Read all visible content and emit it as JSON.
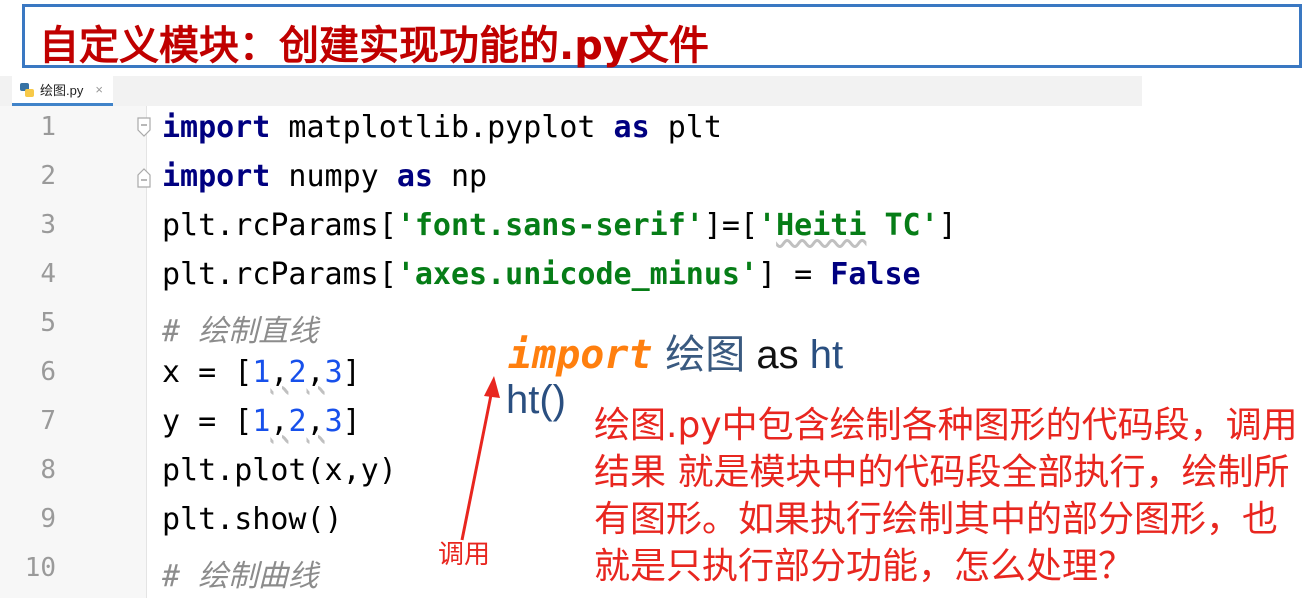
{
  "title": "自定义模块：创建实现功能的.py文件",
  "tab": {
    "filename": "绘图.py",
    "close": "×"
  },
  "editor": {
    "lines": [
      {
        "n": "1"
      },
      {
        "n": "2"
      },
      {
        "n": "3"
      },
      {
        "n": "4"
      },
      {
        "n": "5"
      },
      {
        "n": "6"
      },
      {
        "n": "7"
      },
      {
        "n": "8"
      },
      {
        "n": "9"
      },
      {
        "n": "10"
      }
    ],
    "code": {
      "l1": {
        "kw1": "import",
        "mod": " matplotlib.pyplot ",
        "kw2": "as",
        "alias": " plt"
      },
      "l2": {
        "kw1": "import",
        "mod": " numpy ",
        "kw2": "as",
        "alias": " np"
      },
      "l3": {
        "a": "plt.rcParams[",
        "s1": "'font.sans-serif'",
        "b": "]=[",
        "s2a": "'",
        "s2b": "Heiti",
        "s2c": " TC'",
        "c": "]"
      },
      "l4": {
        "a": "plt.rcParams[",
        "s1": "'axes.unicode_minus'",
        "b": "] = ",
        "kw": "False"
      },
      "l5": {
        "c": "# 绘制直线"
      },
      "l6": {
        "a": "x = [",
        "n1": "1",
        "c1": ",",
        "n2": "2",
        "c2": ",",
        "n3": "3",
        "b": "]"
      },
      "l7": {
        "a": "y = [",
        "n1": "1",
        "c1": ",",
        "n2": "2",
        "c2": ",",
        "n3": "3",
        "b": "]"
      },
      "l8": {
        "a": "plt.plot(x,y)"
      },
      "l9": {
        "a": "plt.show()"
      },
      "l10": {
        "c": "# 绘制曲线"
      }
    }
  },
  "annotation": {
    "import_kw": "import",
    "import_mod": " 绘图",
    "import_as": " as",
    "import_alias": " ht",
    "call": "ht()",
    "arrow_label": "调用",
    "note": "绘图.py中包含绘制各种图形的代码段，调用结果 就是模块中的代码段全部执行，绘制所有图形。如果执行绘制其中的部分图形，也就是只执行部分功能，怎么处理？"
  },
  "colors": {
    "title_red": "#c00000",
    "note_red": "#e8261f",
    "keyword": "#000080",
    "string": "#067d17",
    "number": "#1750eb",
    "import_orange": "#ff7f0e"
  }
}
